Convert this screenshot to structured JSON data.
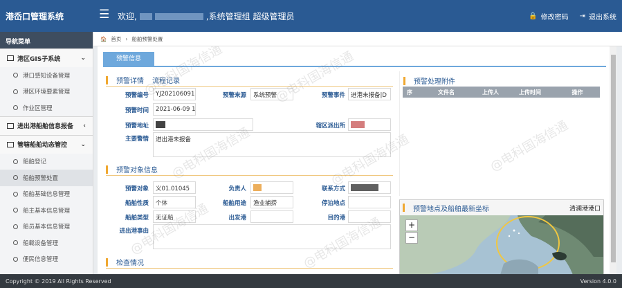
{
  "header": {
    "brand": "港岙口管理系统",
    "welcome_prefix": "欢迎,",
    "welcome_suffix": ",系统管理组 超级管理员",
    "change_password": "修改密码",
    "logout": "退出系统"
  },
  "sidebar": {
    "title": "导航菜单",
    "groups": [
      {
        "label": "港区GIS子系统",
        "items": [
          "港口感知设备管理",
          "港区环境要素管理",
          "作业区管理"
        ]
      },
      {
        "label": "进出港船舶信息报备",
        "items": []
      },
      {
        "label": "管辖船舶动态管控",
        "items": [
          "船舶登记",
          "船舶预警处置",
          "船舶基础信息管理",
          "船主基本信息管理",
          "船员基本信息管理",
          "船载设备管理",
          "便民信息管理"
        ]
      }
    ]
  },
  "breadcrumb": {
    "home": "首页",
    "current": "船舶预警处置"
  },
  "tab": {
    "label": "预警信息"
  },
  "detail": {
    "tab_detail": "预警详情",
    "tab_flow": "流程记录",
    "fields": {
      "alert_no_label": "预警编号",
      "alert_no": "YJ202106091",
      "source_label": "预警来源",
      "source": "系统预警",
      "event_label": "预警事件",
      "event": "进港未报备|D",
      "time_label": "预警时间",
      "time": "2021-06-09 1",
      "addr_label": "预警地址",
      "addr": "",
      "station_label": "辖区派出所",
      "station": "",
      "reason_label": "主要警情",
      "reason": "进出港未报备"
    }
  },
  "target": {
    "title": "预警对象信息",
    "obj_label": "预警对象",
    "obj": "义01.01045",
    "owner_label": "负责人",
    "owner": "",
    "contact_label": "联系方式",
    "contact": "",
    "nature_label": "船舶性质",
    "nature": "个体",
    "use_label": "船舶用途",
    "use": "渔业捕捞",
    "dock_label": "停泊地点",
    "dock": "",
    "type_label": "船舶类型",
    "type": "无证船",
    "depart_label": "出发港",
    "depart": "",
    "dest_label": "目的港",
    "dest": "",
    "inout_label": "进出港事由",
    "inout": ""
  },
  "inspect": {
    "title": "检查情况"
  },
  "attach": {
    "title": "预警处理附件",
    "columns": [
      "序",
      "文件名",
      "上传人",
      "上传时间",
      "操作"
    ]
  },
  "map": {
    "title": "预警地点及船舶最新坐标",
    "place": "清澜港港口",
    "zoom_in": "+",
    "zoom_out": "−"
  },
  "footer": {
    "copyright": "Copyright © 2019 All Rights Reserved",
    "version": "Version 4.0.0"
  },
  "watermark": "@电科国海信通",
  "colors": {
    "header": "#2a5a93",
    "accent": "#f0a830",
    "tab": "#6ea8dc"
  }
}
